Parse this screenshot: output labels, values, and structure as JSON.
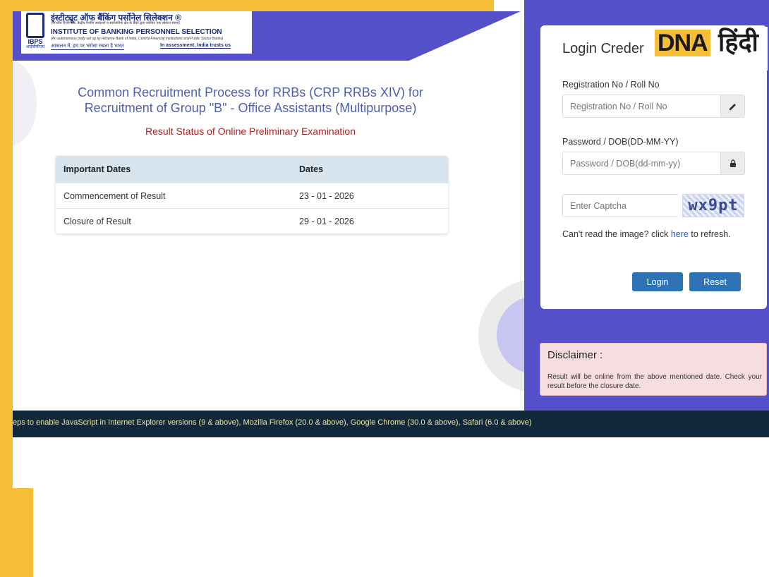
{
  "header": {
    "org_name_hindi": "इंस्टीट्यूट ऑफ बैंकिंग पर्सोनेल सिलेक्शन ®",
    "org_tagline_hindi": "(भारतीय रिज़र्व बैंक, केंद्रीय वित्तीय संस्थाओं व सार्वजनिक क्षेत्र के बैंकों द्वारा स्थापित एक स्वायत्त संस्था)",
    "org_name_english": "INSTITUTE OF BANKING PERSONNEL SELECTION",
    "org_tagline_english": "(An autonomous body set up by Reserve Bank of India, Central Financial Institutions and Public Sector Banks)",
    "motto_hindi": "आकलन में, हम पर भरोसा रखता है भारत",
    "motto_english": "In assessment, India trusts us",
    "logo_abbr": "IBPS",
    "logo_abbr_hindi": "आईबीपीएस"
  },
  "main": {
    "title": "Common Recruitment Process for RRBs (CRP RRBs XIV) for Recruitment of Group \"B\" - Office Assistants (Multipurpose)",
    "subtitle": "Result Status of Online Preliminary Examination",
    "table": {
      "headers": [
        "Important Dates",
        "Dates"
      ],
      "rows": [
        [
          "Commencement of Result",
          "23 - 01 - 2026"
        ],
        [
          "Closure of Result",
          "29 - 01 - 2026"
        ]
      ]
    }
  },
  "login": {
    "title": "Login Creder",
    "reg_label": "Registration No / Roll No",
    "reg_placeholder": "Registration No / Roll No",
    "password_label": "Password / DOB(DD-MM-YY)",
    "password_placeholder": "Password / DOB(dd-mm-yy)",
    "captcha_placeholder": "Enter Captcha",
    "captcha_text": "wx9pt",
    "refresh_prefix": "Can't read the image? click ",
    "refresh_link": "here",
    "refresh_suffix": " to refresh.",
    "login_button": "Login",
    "reset_button": "Reset",
    "pencil_icon": "pencil-icon",
    "lock_icon": "lock-icon"
  },
  "watermark": {
    "dna": "DNA",
    "hindi": "हिंदी"
  },
  "disclaimer": {
    "title": "Disclaimer :",
    "text": "Result will be online from the above mentioned date. Check your result before the closure date."
  },
  "footer": {
    "marquee": "eps to enable JavaScript in Internet Explorer versions (9 & above), Mozilla Firefox (20.0 & above), Google Chrome (30.0 & above), Safari (6.0 & above)"
  },
  "colors": {
    "accent_purple": "#5350c9",
    "frame_yellow": "#f6bd38",
    "title_blue": "#4d5fb4",
    "subtitle_red": "#a82424",
    "button_blue": "#2f73b7",
    "footer_dark": "#10293a"
  }
}
